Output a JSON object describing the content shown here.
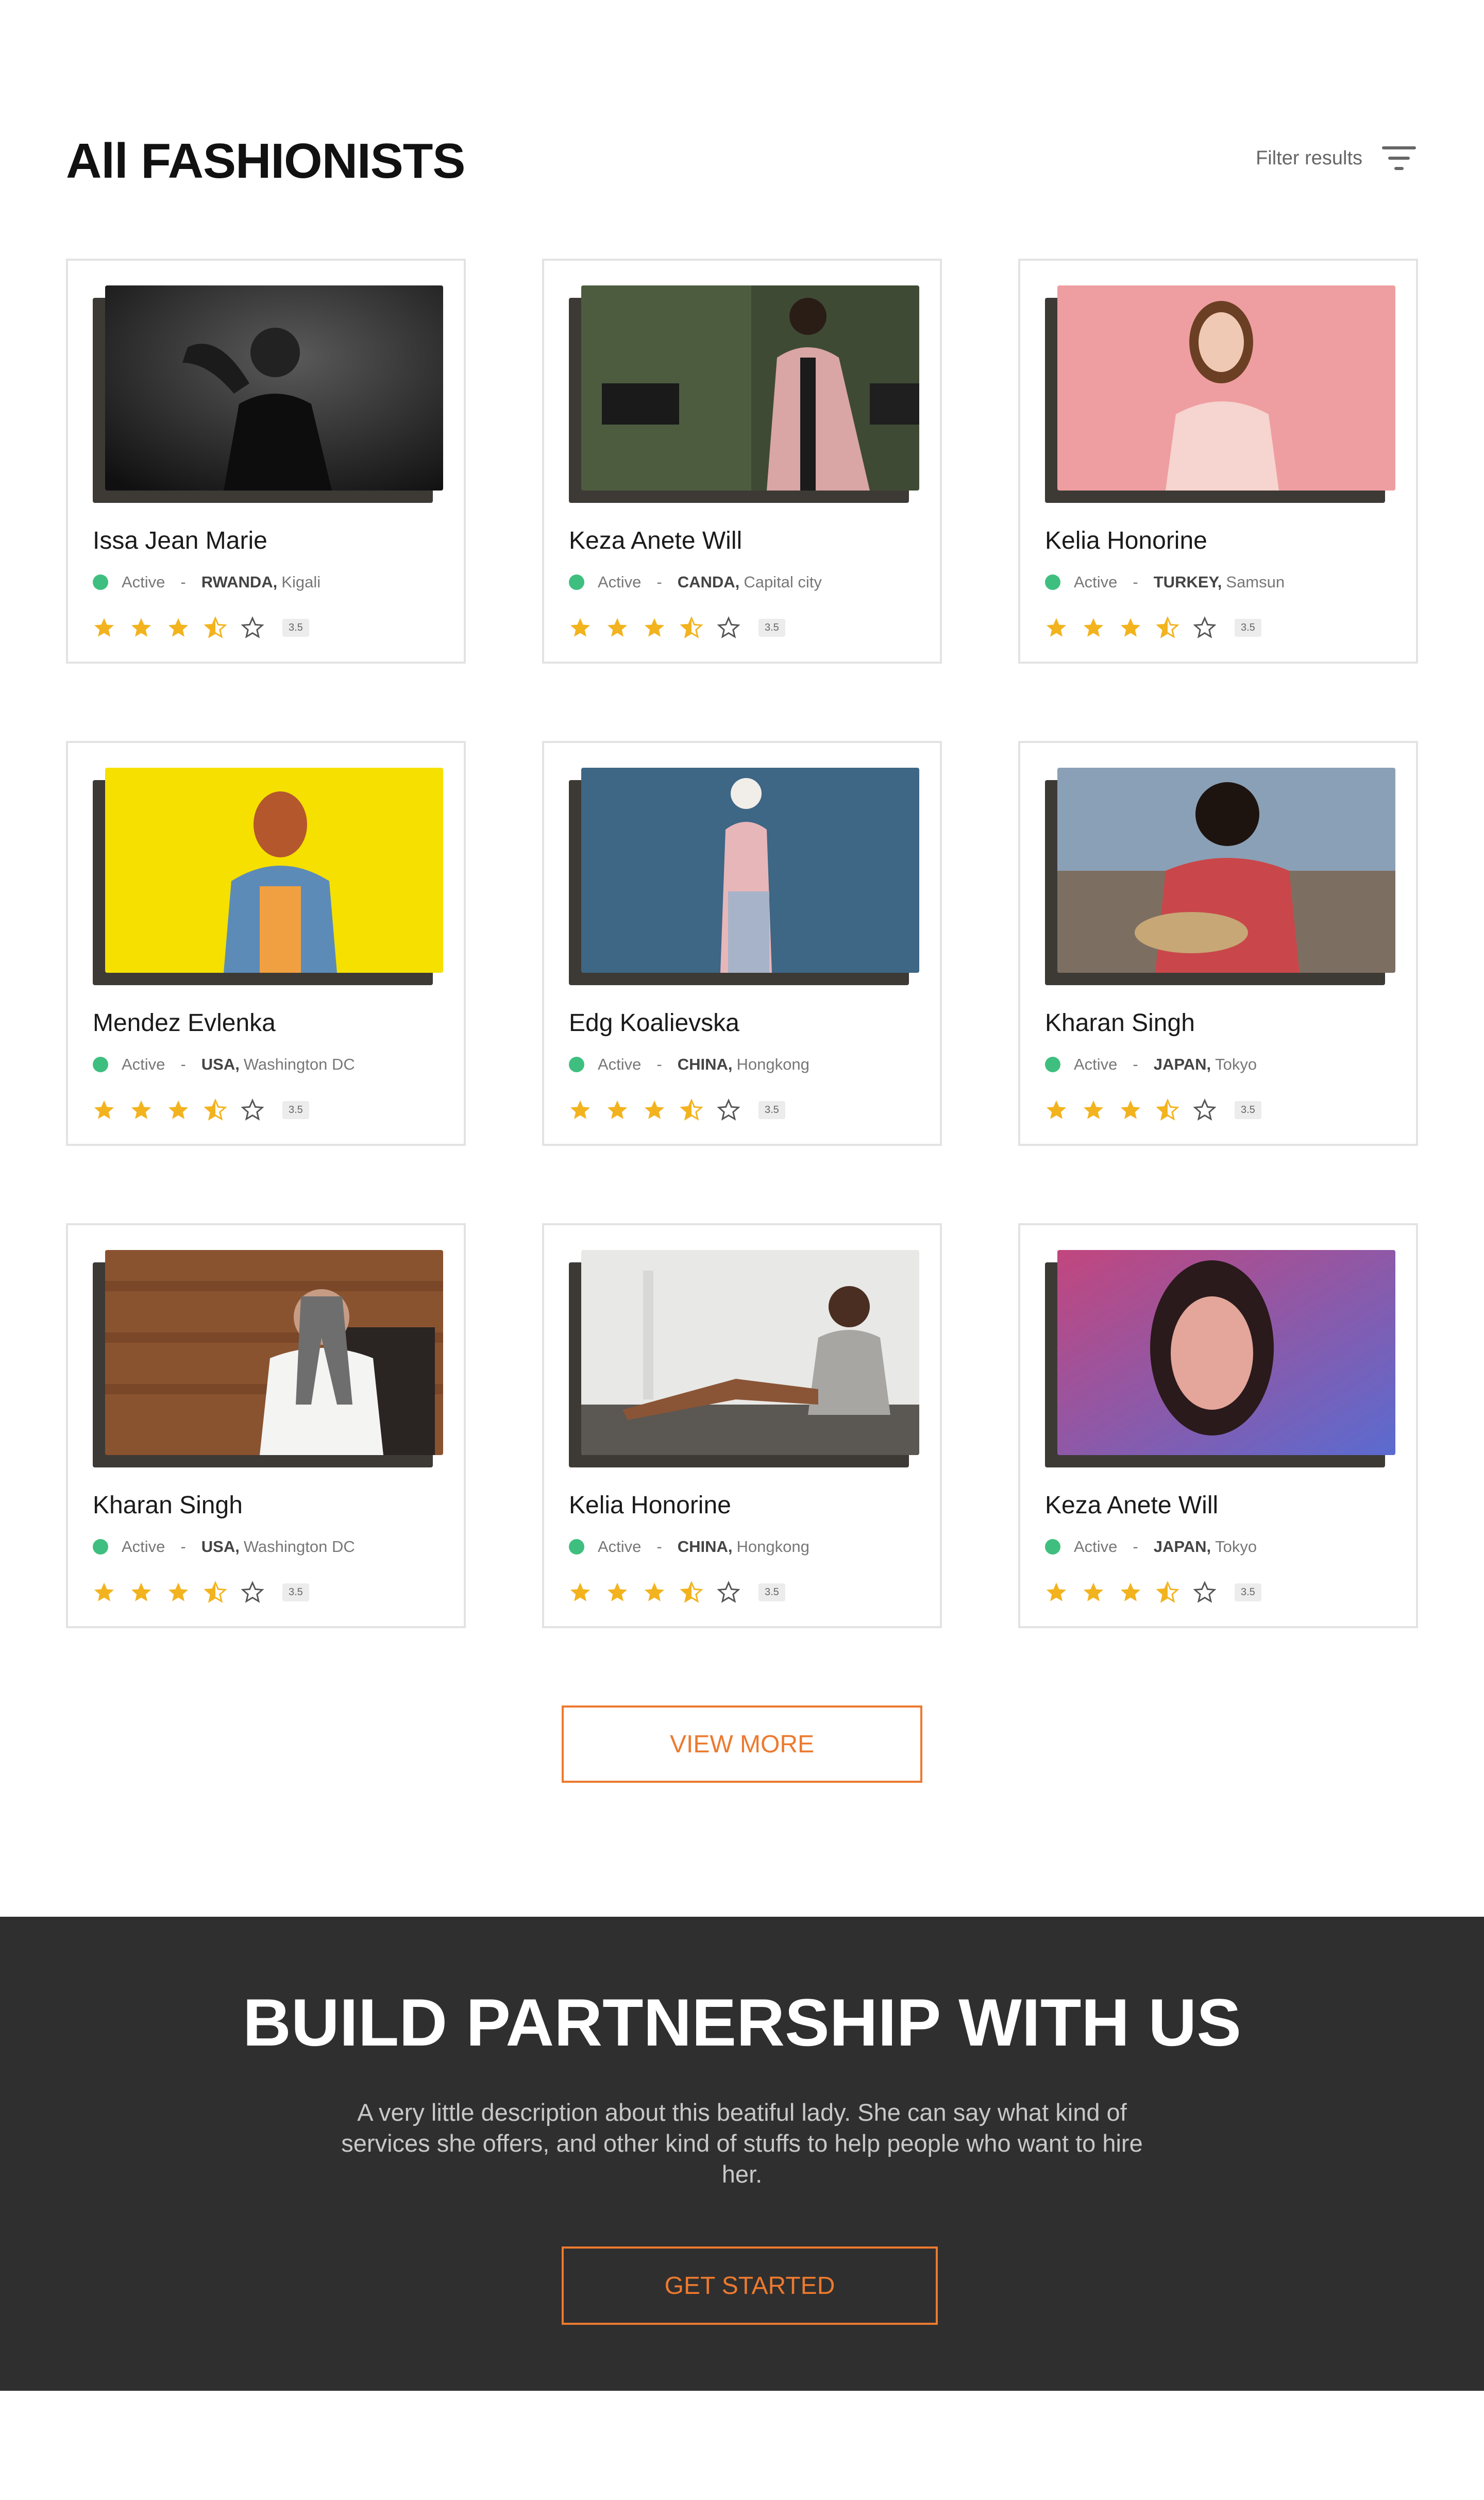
{
  "page": {
    "title": "All FASHIONISTS",
    "filter_label": "Filter results",
    "view_more_label": "VIEW MORE"
  },
  "colors": {
    "accent": "#ec7a2f",
    "status_active": "#3fbf7f",
    "star": "#f2b31e",
    "footer_bg": "#2f2f2f"
  },
  "cards": [
    {
      "name": "Issa Jean Marie",
      "status": "Active",
      "separator": "-",
      "country": "RWANDA,",
      "city": "Kigali",
      "rating": "3.5",
      "rating_value": 3.5
    },
    {
      "name": "Keza Anete Will",
      "status": "Active",
      "separator": "-",
      "country": "CANDA,",
      "city": "Capital city",
      "rating": "3.5",
      "rating_value": 3.5
    },
    {
      "name": "Kelia Honorine",
      "status": "Active",
      "separator": "-",
      "country": "TURKEY,",
      "city": "Samsun",
      "rating": "3.5",
      "rating_value": 3.5
    },
    {
      "name": "Mendez Evlenka",
      "status": "Active",
      "separator": "-",
      "country": "USA,",
      "city": "Washington DC",
      "rating": "3.5",
      "rating_value": 3.5
    },
    {
      "name": "Edg Koalievska",
      "status": "Active",
      "separator": "-",
      "country": "CHINA,",
      "city": "Hongkong",
      "rating": "3.5",
      "rating_value": 3.5
    },
    {
      "name": "Kharan Singh",
      "status": "Active",
      "separator": "-",
      "country": "JAPAN,",
      "city": "Tokyo",
      "rating": "3.5",
      "rating_value": 3.5
    },
    {
      "name": "Kharan Singh",
      "status": "Active",
      "separator": "-",
      "country": "USA,",
      "city": "Washington DC",
      "rating": "3.5",
      "rating_value": 3.5
    },
    {
      "name": "Kelia Honorine",
      "status": "Active",
      "separator": "-",
      "country": "CHINA,",
      "city": "Hongkong",
      "rating": "3.5",
      "rating_value": 3.5
    },
    {
      "name": "Keza Anete Will",
      "status": "Active",
      "separator": "-",
      "country": "JAPAN,",
      "city": "Tokyo",
      "rating": "3.5",
      "rating_value": 3.5
    }
  ],
  "cta": {
    "title": "BUILD PARTNERSHIP WITH US",
    "description": "A very little description about this beatiful lady. She can say what kind of services she offers, and other kind of stuffs to help people who want to hire her.",
    "button_label": "GET STARTED"
  }
}
